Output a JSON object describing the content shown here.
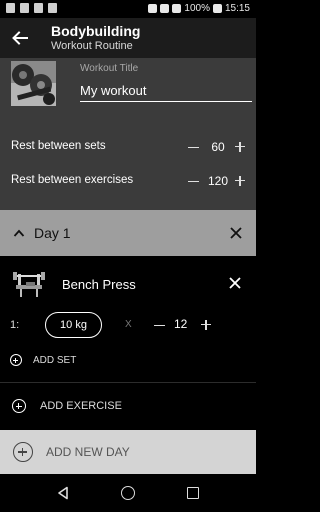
{
  "status_bar": {
    "battery": "100%",
    "time": "15:15",
    "icons": [
      "message-icon",
      "image-icon",
      "sim-icon",
      "notification-icon",
      "alarm-icon",
      "wifi-icon",
      "signal-icon",
      "battery-icon"
    ]
  },
  "app_bar": {
    "title": "Bodybuilding",
    "subtitle": "Workout Routine",
    "back_icon": "arrow-back-icon"
  },
  "workout": {
    "title_label": "Workout Title",
    "title_value": "My workout",
    "rest_between_sets": {
      "label": "Rest between sets",
      "value": "60"
    },
    "rest_between_exercises": {
      "label": "Rest between exercises",
      "value": "120"
    }
  },
  "day": {
    "label": "Day 1",
    "exercise": {
      "name": "Bench Press",
      "set": {
        "index": "1:",
        "weight": "10 kg",
        "separator": "X",
        "reps": "12"
      },
      "add_set_label": "ADD SET"
    },
    "add_exercise_label": "ADD EXERCISE"
  },
  "add_day_label": "ADD NEW DAY",
  "colors": {
    "app_bar_bg": "#1c1c1c",
    "header_bg": "#3b3b3b",
    "day_header_bg": "#9e9e9e",
    "add_day_bg": "#d4d4d4"
  }
}
